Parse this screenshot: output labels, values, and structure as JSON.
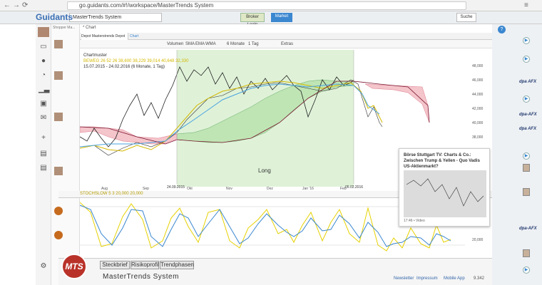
{
  "browser": {
    "url": "go.guidants.com/#!/workspace/MasterTrends System"
  },
  "app": {
    "logo": "Guidants",
    "tab_title": "MasterTrends System",
    "broker_login": "Broker Login",
    "market": "Market",
    "search": "Suche"
  },
  "news_header": "Shopper Ma...",
  "chart_panel": {
    "breadcrumb": "* Chart",
    "tab1": "Depot Masterstrends Depot (ind.)",
    "tab2": "Chart",
    "toolbar": [
      "Volumen",
      "SMA",
      "EMA",
      "WMA",
      "6 Monate",
      "1 Tag",
      "Extras"
    ],
    "legend_line1": "Chartmuster",
    "legend_line2": "BEWEG 26 52 26 38,600 38,229 39,014 40,648 32,330",
    "legend_line3": "15.07.2015 - 24.02.2016 (6 Monate, 1 Tag)",
    "region_label": "Long",
    "x_ticks": [
      "Aug",
      "Sep",
      "Okt",
      "Nov",
      "Dez",
      "Jan '16",
      "Feb"
    ],
    "date_marker_1": "24.09.2015",
    "date_marker_2": "05.02.2016",
    "y_ticks": [
      "48,000",
      "46,000",
      "44,000",
      "42,000",
      "40,000",
      "38,000"
    ]
  },
  "oscillator": {
    "label": "STOCHSLOW 5 3 20,000 20,000",
    "level_high": "20,000"
  },
  "bottom_tabs": [
    "Steckbrief",
    "Risikoprofil",
    "Trendphasen"
  ],
  "bottom_title": "MasterTrends System",
  "logo_text": "MTS",
  "popup": {
    "title": "Börse Stuttgart TV: Charts & Co.: Zwischen Trump & Yellen - Quo Vadis US-Aktienmarkt?",
    "footer": "17:46 • Video"
  },
  "footer": {
    "newsletter": "Newsletter",
    "impressum": "Impressum",
    "mobile": "Mobile App",
    "count": "9.342"
  },
  "right_sidebar": {
    "brand1": "dpa AFX",
    "brand2": "dpa-AFX"
  },
  "colors": {
    "accent": "#3b87d0",
    "kijun": "#4aa3df",
    "tenkan": "#d4b800",
    "cloud_green": "#c7eac0",
    "cloud_red": "#f4c5cb"
  }
}
